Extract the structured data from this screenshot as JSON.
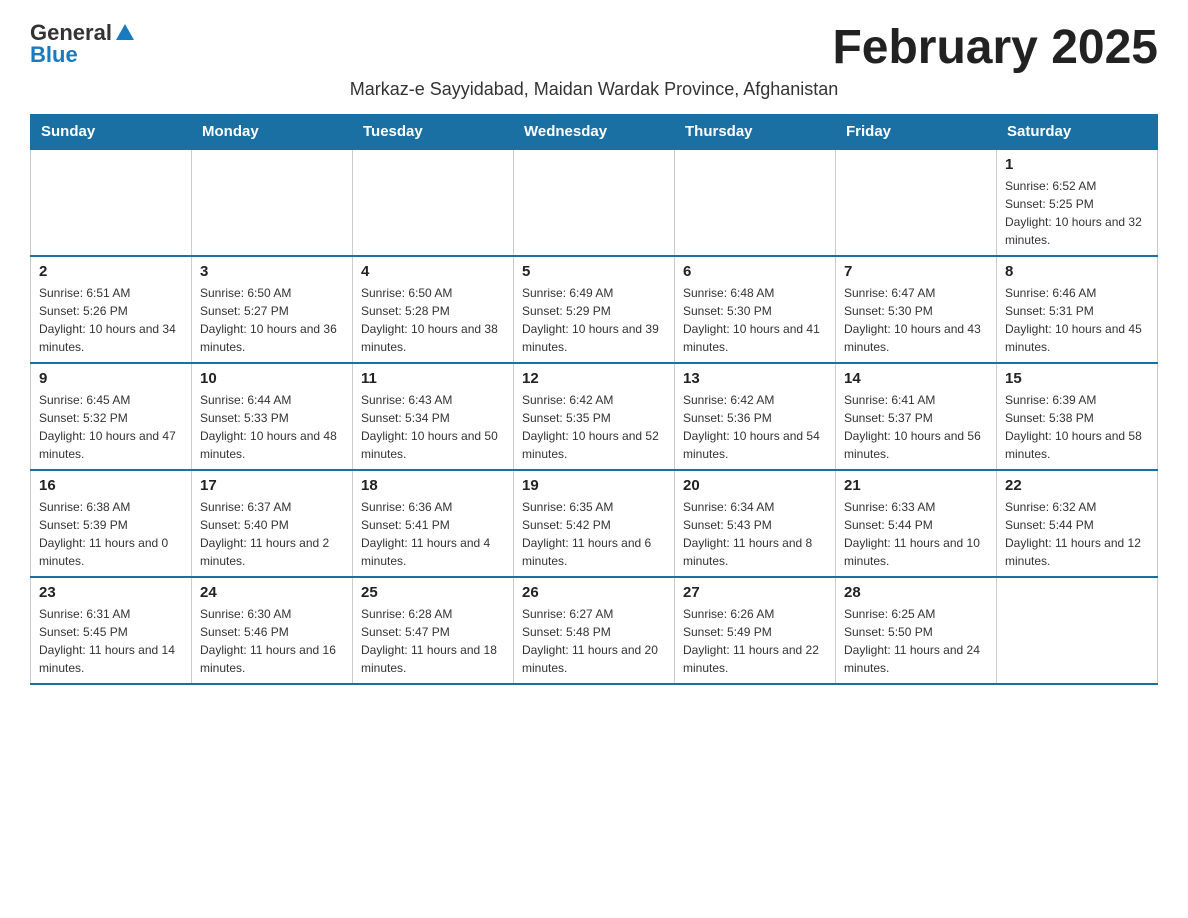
{
  "header": {
    "logo_general": "General",
    "logo_blue": "Blue",
    "title": "February 2025",
    "subtitle": "Markaz-e Sayyidabad, Maidan Wardak Province, Afghanistan"
  },
  "calendar": {
    "days_of_week": [
      "Sunday",
      "Monday",
      "Tuesday",
      "Wednesday",
      "Thursday",
      "Friday",
      "Saturday"
    ],
    "weeks": [
      [
        {
          "day": "",
          "info": ""
        },
        {
          "day": "",
          "info": ""
        },
        {
          "day": "",
          "info": ""
        },
        {
          "day": "",
          "info": ""
        },
        {
          "day": "",
          "info": ""
        },
        {
          "day": "",
          "info": ""
        },
        {
          "day": "1",
          "info": "Sunrise: 6:52 AM\nSunset: 5:25 PM\nDaylight: 10 hours and 32 minutes."
        }
      ],
      [
        {
          "day": "2",
          "info": "Sunrise: 6:51 AM\nSunset: 5:26 PM\nDaylight: 10 hours and 34 minutes."
        },
        {
          "day": "3",
          "info": "Sunrise: 6:50 AM\nSunset: 5:27 PM\nDaylight: 10 hours and 36 minutes."
        },
        {
          "day": "4",
          "info": "Sunrise: 6:50 AM\nSunset: 5:28 PM\nDaylight: 10 hours and 38 minutes."
        },
        {
          "day": "5",
          "info": "Sunrise: 6:49 AM\nSunset: 5:29 PM\nDaylight: 10 hours and 39 minutes."
        },
        {
          "day": "6",
          "info": "Sunrise: 6:48 AM\nSunset: 5:30 PM\nDaylight: 10 hours and 41 minutes."
        },
        {
          "day": "7",
          "info": "Sunrise: 6:47 AM\nSunset: 5:30 PM\nDaylight: 10 hours and 43 minutes."
        },
        {
          "day": "8",
          "info": "Sunrise: 6:46 AM\nSunset: 5:31 PM\nDaylight: 10 hours and 45 minutes."
        }
      ],
      [
        {
          "day": "9",
          "info": "Sunrise: 6:45 AM\nSunset: 5:32 PM\nDaylight: 10 hours and 47 minutes."
        },
        {
          "day": "10",
          "info": "Sunrise: 6:44 AM\nSunset: 5:33 PM\nDaylight: 10 hours and 48 minutes."
        },
        {
          "day": "11",
          "info": "Sunrise: 6:43 AM\nSunset: 5:34 PM\nDaylight: 10 hours and 50 minutes."
        },
        {
          "day": "12",
          "info": "Sunrise: 6:42 AM\nSunset: 5:35 PM\nDaylight: 10 hours and 52 minutes."
        },
        {
          "day": "13",
          "info": "Sunrise: 6:42 AM\nSunset: 5:36 PM\nDaylight: 10 hours and 54 minutes."
        },
        {
          "day": "14",
          "info": "Sunrise: 6:41 AM\nSunset: 5:37 PM\nDaylight: 10 hours and 56 minutes."
        },
        {
          "day": "15",
          "info": "Sunrise: 6:39 AM\nSunset: 5:38 PM\nDaylight: 10 hours and 58 minutes."
        }
      ],
      [
        {
          "day": "16",
          "info": "Sunrise: 6:38 AM\nSunset: 5:39 PM\nDaylight: 11 hours and 0 minutes."
        },
        {
          "day": "17",
          "info": "Sunrise: 6:37 AM\nSunset: 5:40 PM\nDaylight: 11 hours and 2 minutes."
        },
        {
          "day": "18",
          "info": "Sunrise: 6:36 AM\nSunset: 5:41 PM\nDaylight: 11 hours and 4 minutes."
        },
        {
          "day": "19",
          "info": "Sunrise: 6:35 AM\nSunset: 5:42 PM\nDaylight: 11 hours and 6 minutes."
        },
        {
          "day": "20",
          "info": "Sunrise: 6:34 AM\nSunset: 5:43 PM\nDaylight: 11 hours and 8 minutes."
        },
        {
          "day": "21",
          "info": "Sunrise: 6:33 AM\nSunset: 5:44 PM\nDaylight: 11 hours and 10 minutes."
        },
        {
          "day": "22",
          "info": "Sunrise: 6:32 AM\nSunset: 5:44 PM\nDaylight: 11 hours and 12 minutes."
        }
      ],
      [
        {
          "day": "23",
          "info": "Sunrise: 6:31 AM\nSunset: 5:45 PM\nDaylight: 11 hours and 14 minutes."
        },
        {
          "day": "24",
          "info": "Sunrise: 6:30 AM\nSunset: 5:46 PM\nDaylight: 11 hours and 16 minutes."
        },
        {
          "day": "25",
          "info": "Sunrise: 6:28 AM\nSunset: 5:47 PM\nDaylight: 11 hours and 18 minutes."
        },
        {
          "day": "26",
          "info": "Sunrise: 6:27 AM\nSunset: 5:48 PM\nDaylight: 11 hours and 20 minutes."
        },
        {
          "day": "27",
          "info": "Sunrise: 6:26 AM\nSunset: 5:49 PM\nDaylight: 11 hours and 22 minutes."
        },
        {
          "day": "28",
          "info": "Sunrise: 6:25 AM\nSunset: 5:50 PM\nDaylight: 11 hours and 24 minutes."
        },
        {
          "day": "",
          "info": ""
        }
      ]
    ]
  }
}
